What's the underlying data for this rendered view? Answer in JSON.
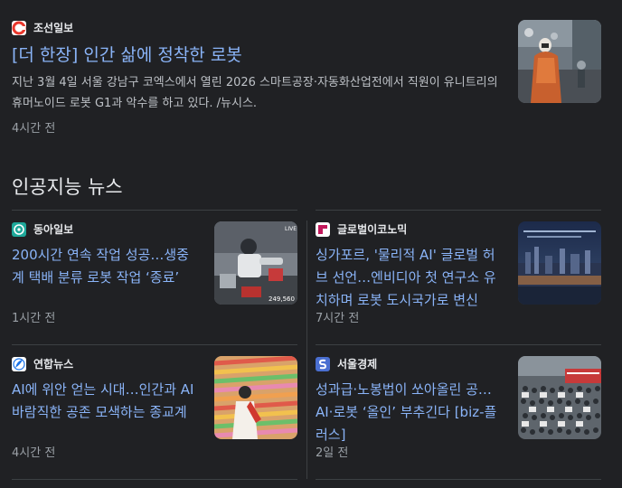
{
  "top_story": {
    "source": "조선일보",
    "title": "[더 한장] 인간 삶에 정착한 로봇",
    "snippet": "지난 3월 4일 서울 강남구 코엑스에서 열린 2026 스마트공장·자동화산업전에서 직원이 유니트리의 휴머노이드 로봇 G1과 악수를 하고 있다. /뉴시스.",
    "time": "4시간 전",
    "source_color": "#e8372c",
    "source_icon": "c-logo-icon"
  },
  "section": {
    "heading": "인공지능 뉴스"
  },
  "cards": [
    {
      "source": "동아일보",
      "title": "200시간 연속 작업 성공…생중계 택배 분류 로봇 작업 ‘종료’",
      "time": "1시간 전",
      "source_color": "#1ea89a",
      "thumb_badge": "LIVE",
      "thumb_counter": "249,560"
    },
    {
      "source": "글로벌이코노믹",
      "title": "싱가포르, '물리적 AI' 글로벌 허브 선언…엔비디아 첫 연구소 유치하며 로봇 도시국가로 변신",
      "time": "7시간 전",
      "source_color": "#c2185b"
    },
    {
      "source": "연합뉴스",
      "title": "AI에 위안 얻는 시대…인간과 AI 바람직한 공존 모색하는 종교계",
      "time": "4시간 전",
      "source_color": "#1a73e8"
    },
    {
      "source": "서울경제",
      "title": "성과급·노봉법이 쏘아올린 공… AI·로봇 ‘올인’ 부추긴다 [biz-플러스]",
      "time": "2일 전",
      "source_color": "#4a6fd1"
    }
  ]
}
